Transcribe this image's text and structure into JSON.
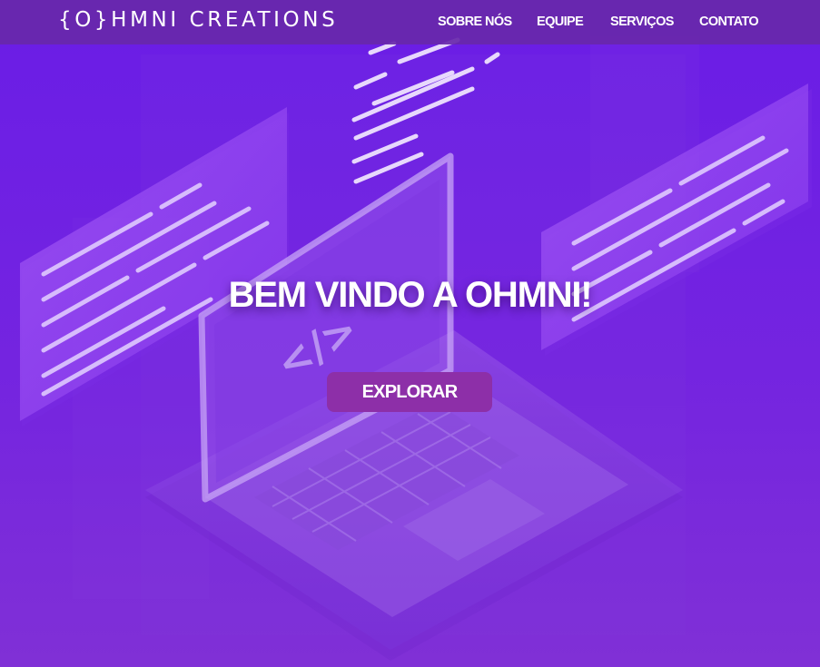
{
  "navbar": {
    "brand": "{O}HMNI CREATIONS",
    "links": [
      "SOBRE NÓS",
      "EQUIPE",
      "SERVIÇOS",
      "CONTATO"
    ]
  },
  "hero": {
    "title": "BEM VINDO A OHMNI!",
    "button_label": "EXPLORAR",
    "code_glyph": "</>"
  },
  "colors": {
    "background": "#6a1de6",
    "navbar": "#6828aa",
    "button": "#8d2fa8",
    "text": "#ffffff"
  },
  "icons": [
    "laptop-illustration",
    "code-panel-left",
    "code-panel-right",
    "code-stream-top"
  ]
}
